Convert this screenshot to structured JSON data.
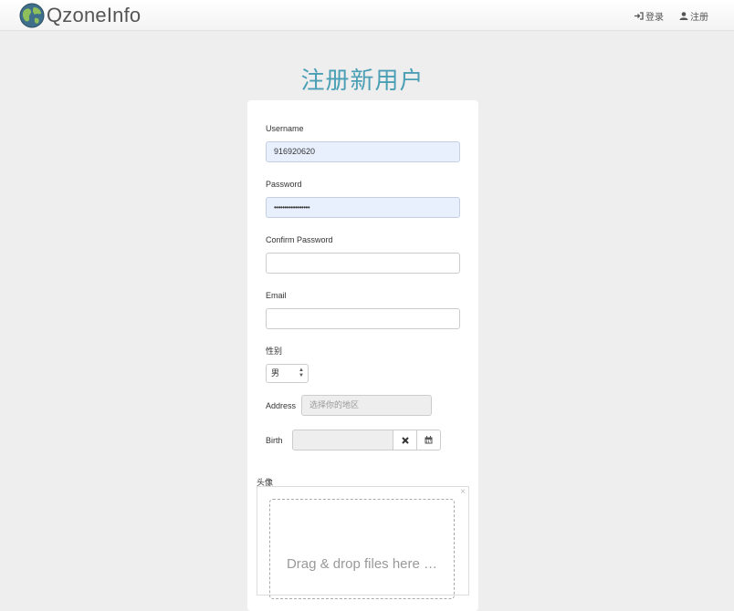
{
  "navbar": {
    "brand": "QzoneInfo",
    "login": "登录",
    "register": "注册"
  },
  "page": {
    "title": "注册新用户"
  },
  "form": {
    "username": {
      "label": "Username",
      "value": "916920620"
    },
    "password": {
      "label": "Password",
      "value": "•••••••••••••••••"
    },
    "confirm_password": {
      "label": "Confirm Password",
      "value": ""
    },
    "email": {
      "label": "Email",
      "value": ""
    },
    "gender": {
      "label": "性别",
      "selected": "男"
    },
    "address": {
      "label": "Address",
      "placeholder": "选择你的地区"
    },
    "birth": {
      "label": "Birth",
      "value": ""
    },
    "avatar": {
      "label": "头像",
      "dropzone_text": "Drag & drop files here …",
      "close": "×"
    }
  },
  "icons": {
    "brand": "globe-icon",
    "login": "sign-in-icon",
    "register": "user-icon",
    "clear": "remove-icon",
    "calendar": "calendar-icon"
  },
  "colors": {
    "title": "#4a9fb5",
    "autofill": "#e8f0fe",
    "background": "#eeeeee"
  }
}
